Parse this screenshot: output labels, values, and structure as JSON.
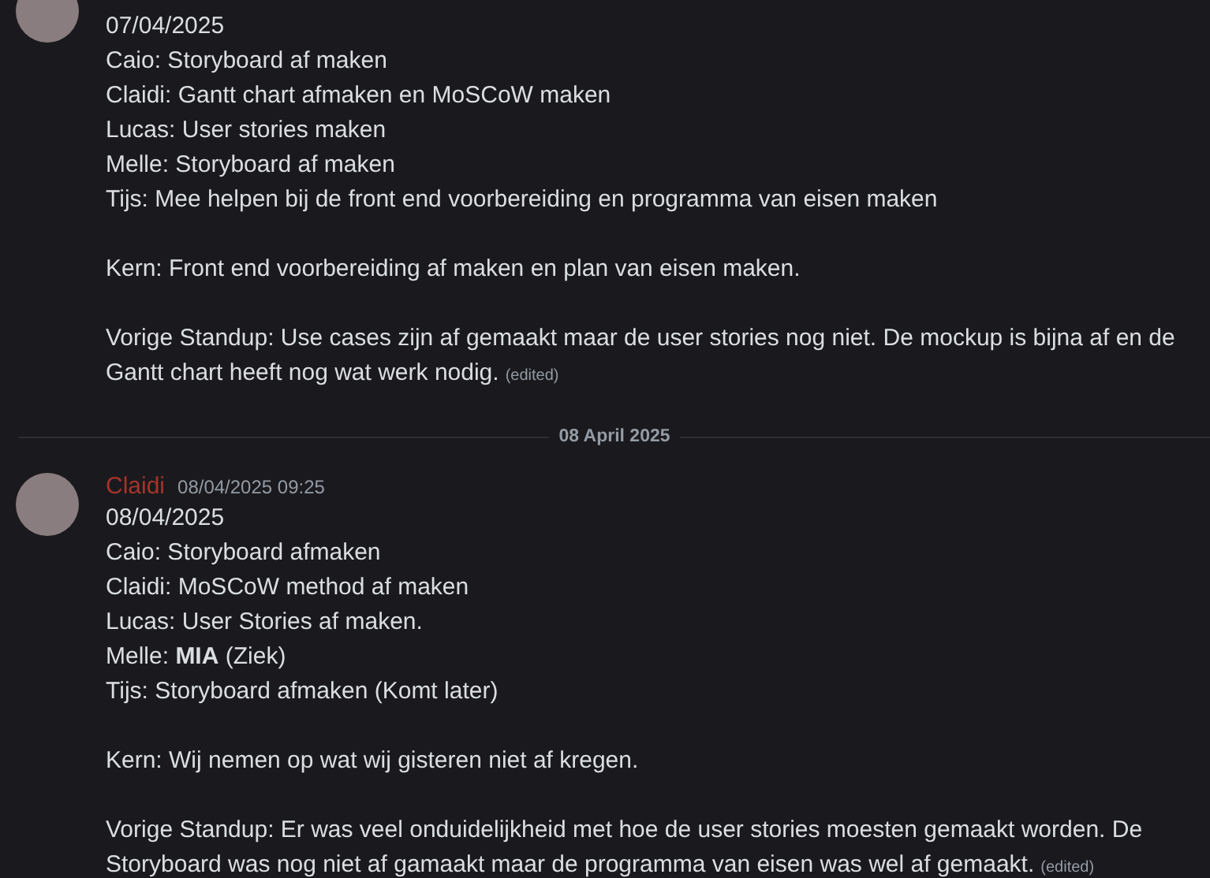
{
  "messages": [
    {
      "paragraphs": [
        [
          "07/04/2025",
          "Caio: Storyboard af maken",
          "Claidi: Gantt chart afmaken en MoSCoW maken",
          "Lucas: User stories maken",
          "Melle: Storyboard af maken",
          "Tijs: Mee helpen bij de front end voorbereiding en programma van eisen maken"
        ],
        [
          "Kern: Front end voorbereiding af maken en plan van eisen maken."
        ],
        [
          "Vorige Standup: Use cases zijn af gemaakt maar de user stories nog niet. De mockup is bijna af en de",
          "Gantt chart heeft nog wat werk nodig."
        ]
      ],
      "edited": "(edited)"
    },
    {
      "divider": "08 April 2025",
      "author": "Claidi",
      "color": "#a8332b",
      "timestamp": "08/04/2025 09:25",
      "paragraphs": [
        [
          "08/04/2025",
          "Caio: Storyboard afmaken",
          "Claidi: MoSCoW method af maken",
          "Lucas: User Stories af maken.",
          "Melle: **MIA** (Ziek)",
          "Tijs: Storyboard afmaken (Komt later)"
        ],
        [
          "Kern: Wij nemen op wat wij gisteren niet af kregen."
        ],
        [
          "Vorige Standup: Er was veel onduidelijkheid met hoe de user stories moesten gemaakt worden. De",
          "Storyboard was nog niet af gamaakt maar de programma van eisen was wel af gemaakt."
        ]
      ],
      "edited": "(edited)"
    }
  ]
}
